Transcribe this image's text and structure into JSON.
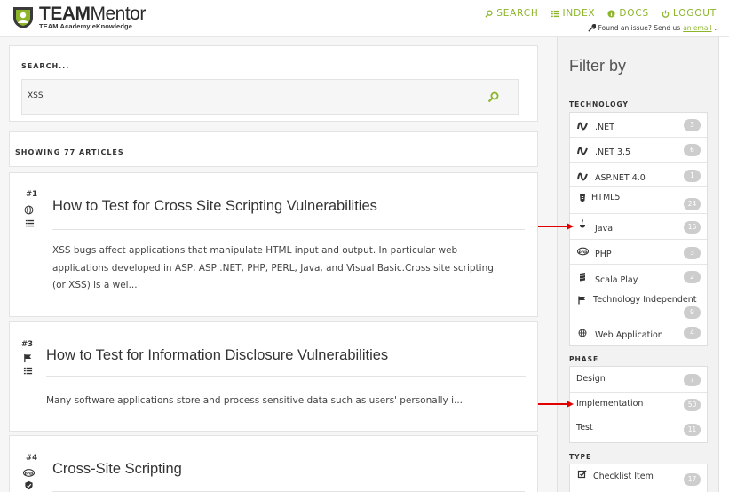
{
  "header": {
    "logo_title_bold": "TEAM",
    "logo_title_rest": "Mentor",
    "logo_subtitle": "TEAM Academy eKnowledge",
    "nav": [
      {
        "label": "SEARCH",
        "icon": "search-icon"
      },
      {
        "label": "INDEX",
        "icon": "list-icon"
      },
      {
        "label": "DOCS",
        "icon": "info-icon"
      },
      {
        "label": "LOGOUT",
        "icon": "power-icon"
      }
    ],
    "issue_text": "Found an issue? Send us",
    "issue_link": "an email",
    "issue_end": "."
  },
  "search": {
    "label": "SEARCH...",
    "value": "XSS"
  },
  "results": {
    "count_label": "SHOWING 77 ARTICLES"
  },
  "articles": [
    {
      "num": "#1",
      "title": "How to Test for Cross Site Scripting Vulnerabilities",
      "desc_lines": [
        "XSS bugs affect applications that manipulate HTML input and output. In particular web",
        "applications developed in ASP, ASP .NET, PHP, PERL, Java, and Visual Basic.Cross site scripting",
        "(or XSS) is a wel..."
      ],
      "icons": [
        "globe-icon",
        "list-icon"
      ]
    },
    {
      "num": "#3",
      "title": "How to Test for Information Disclosure Vulnerabilities",
      "desc_lines": [
        "Many software applications store and process sensitive data such as users' personally i..."
      ],
      "icons": [
        "flag-icon",
        "list-icon"
      ]
    },
    {
      "num": "#4",
      "title": "Cross-Site Scripting",
      "desc_lines": [],
      "icons": [
        "php-icon",
        "shield-icon"
      ]
    }
  ],
  "sidebar": {
    "title": "Filter by",
    "technology": {
      "title": "TECHNOLOGY",
      "items": [
        {
          "label": ".NET",
          "count": "3",
          "icon": "dotnet-icon"
        },
        {
          "label": ".NET 3.5",
          "count": "6",
          "icon": "dotnet-icon"
        },
        {
          "label": "ASP.NET 4.0",
          "count": "1",
          "icon": "dotnet-icon"
        },
        {
          "label": "HTML5",
          "count": "24",
          "icon": "html5-icon"
        },
        {
          "label": "Java",
          "count": "16",
          "icon": "java-icon"
        },
        {
          "label": "PHP",
          "count": "3",
          "icon": "php-icon"
        },
        {
          "label": "Scala Play",
          "count": "2",
          "icon": "scala-icon"
        },
        {
          "label": "Technology Independent",
          "count": "9",
          "icon": "flag-icon"
        },
        {
          "label": "Web Application",
          "count": "4",
          "icon": "globe-icon"
        }
      ]
    },
    "phase": {
      "title": "PHASE",
      "items": [
        {
          "label": "Design",
          "count": "7"
        },
        {
          "label": "Implementation",
          "count": "50"
        },
        {
          "label": "Test",
          "count": "11"
        }
      ]
    },
    "type": {
      "title": "TYPE",
      "items": [
        {
          "label": "Checklist Item",
          "count": "17",
          "icon": "checkbox-icon"
        }
      ]
    }
  },
  "colors": {
    "accent": "#8cb52a",
    "arrow": "#e00000",
    "badge": "#cdcdcd"
  }
}
